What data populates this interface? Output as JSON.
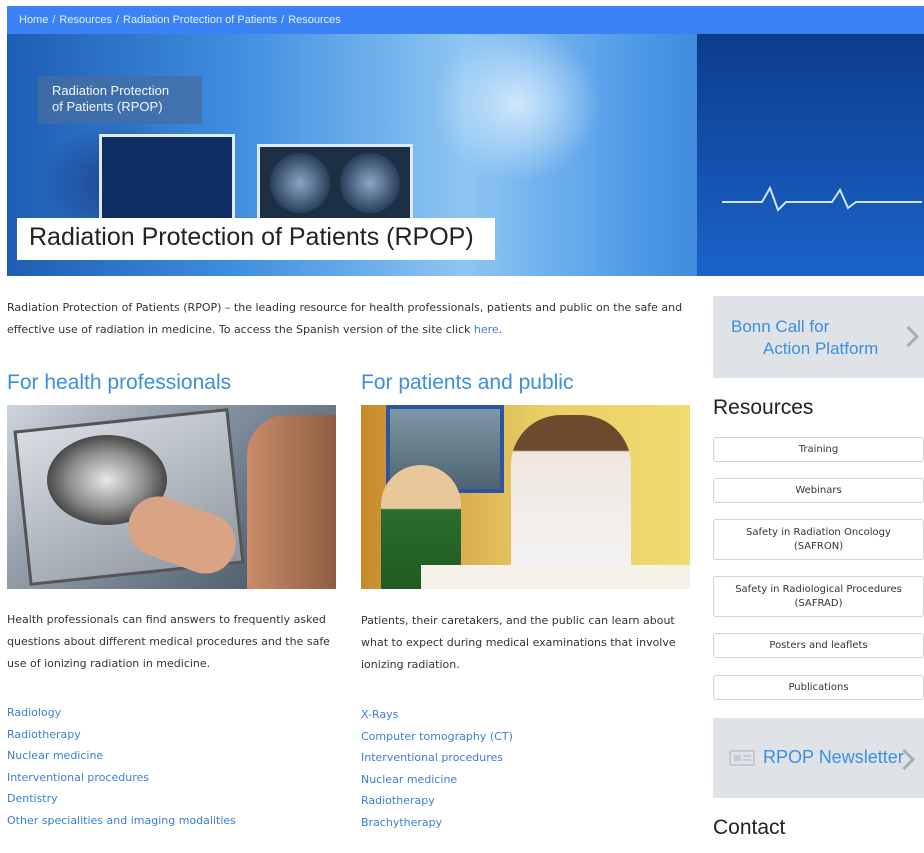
{
  "breadcrumb": {
    "items": [
      "Home",
      "Resources",
      "Radiation Protection of Patients",
      "Resources"
    ],
    "separator": "/"
  },
  "hero": {
    "tag_line1": "Radiation Protection",
    "tag_line2": "of Patients (RPOP)",
    "title": "Radiation Protection of Patients (RPOP)"
  },
  "intro": {
    "text": "Radiation Protection of Patients (RPOP) – the leading resource for health professionals, patients and public on the safe and effective use of radiation in medicine. To access the Spanish version of the site click",
    "link": "here",
    "end": "."
  },
  "health": {
    "title": "For health professionals",
    "description": "Health professionals can find answers to frequently asked questions about different medical procedures and the safe use of ionizing radiation in medicine.",
    "links": [
      "Radiology",
      "Radiotherapy",
      "Nuclear medicine",
      "Interventional procedures",
      "Dentistry",
      "Other specialities and imaging modalities"
    ]
  },
  "patients": {
    "title": "For patients and public",
    "description": "Patients, their caretakers, and the public can learn about what to expect during medical examinations that involve ionizing radiation.",
    "links": [
      "X-Rays",
      "Computer tomography (CT)",
      "Interventional procedures",
      "Nuclear medicine",
      "Radiotherapy",
      "Brachytherapy"
    ]
  },
  "sidebar": {
    "bonn_line1": "Bonn Call for",
    "bonn_line2": "Action Platform",
    "resources_heading": "Resources",
    "resources": [
      "Training",
      "Webinars",
      "Safety in Radiation Oncology (SAFRON)",
      "Safety in Radiological Procedures (SAFRAD)",
      "Posters and leaflets",
      "Publications"
    ],
    "newsletter": "RPOP Newsletter",
    "contact_heading": "Contact"
  },
  "colors": {
    "accent": "#3a8fe0",
    "breadcrumb_bg": "#3b82f6",
    "sidebar_box": "#dfe3e8"
  }
}
